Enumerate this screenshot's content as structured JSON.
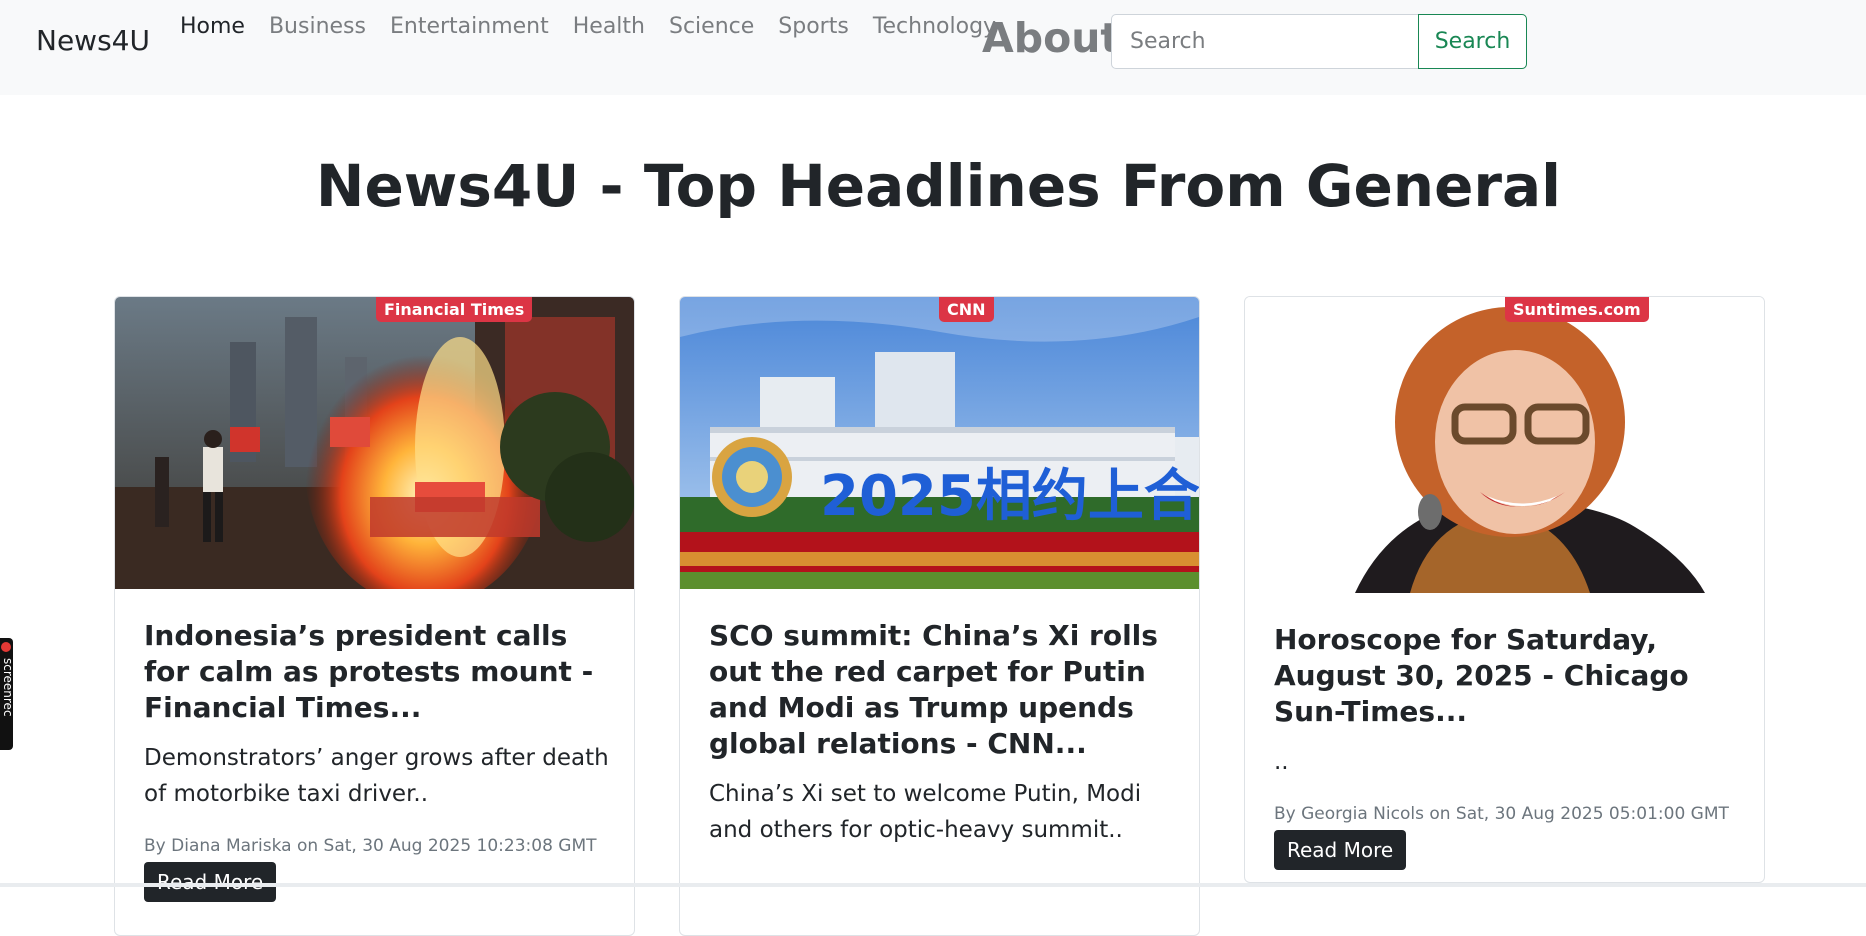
{
  "navbar": {
    "brand": "News4U",
    "links": [
      "Home",
      "Business",
      "Entertainment",
      "Health",
      "Science",
      "Sports",
      "Technology"
    ],
    "about": "About",
    "search_placeholder": "Search",
    "search_button": "Search"
  },
  "page_title": "News4U - Top Headlines From General",
  "articles": [
    {
      "source": "Financial Times",
      "title": "Indonesia’s president calls for calm as protests mount - Financial Times...",
      "description": "Demonstrators’ anger grows after death of motorbike taxi driver..",
      "meta": "By Diana Mariska on Sat, 30 Aug 2025 10:23:08 GMT",
      "button": "Read More"
    },
    {
      "source": "CNN",
      "title": "SCO summit: China’s Xi rolls out the red carpet for Putin and Modi as Trump upends global relations - CNN...",
      "description": "China’s Xi set to welcome Putin, Modi and others for optic-heavy summit..",
      "meta": "",
      "button": ""
    },
    {
      "source": "Suntimes.com",
      "title": "Horoscope for Saturday, August 30, 2025 - Chicago Sun-Times...",
      "description": "..",
      "meta": "By Georgia Nicols on Sat, 30 Aug 2025 05:01:00 GMT",
      "button": "Read More"
    }
  ],
  "image_text": {
    "sco_sign": "2025相约上合"
  },
  "recorder": {
    "label": "screenrec"
  },
  "colors": {
    "navbar_bg": "#f8f9fa",
    "badge": "#dc3545",
    "search_green": "#198754",
    "button_dark": "#212529"
  }
}
